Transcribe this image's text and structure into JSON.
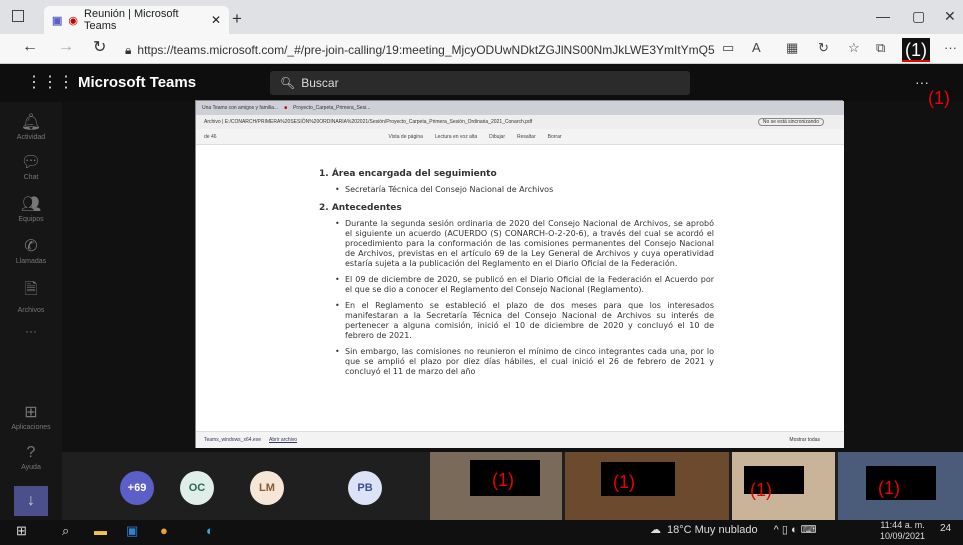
{
  "browser": {
    "tab_title": "Reunión | Microsoft Teams",
    "tab_close": "✕",
    "new_tab": "+",
    "url_prefix": "https://",
    "url": "https://teams.microsoft.com/_#/pre-join-calling/19:meeting_MjcyODUwNDktZGJlNS00NmJkLWE3YmItYmQ5NTcxN...",
    "redacted_label": "(1)",
    "win_min": "—",
    "win_max": "▢",
    "win_close": "✕",
    "more": "···"
  },
  "teams": {
    "brand": "Microsoft Teams",
    "search_placeholder": "Buscar",
    "more": "···",
    "rail": [
      {
        "label": "Actividad",
        "icon": "bell-icon"
      },
      {
        "label": "Chat",
        "icon": "chat-icon"
      },
      {
        "label": "Equipos",
        "icon": "teams-icon"
      },
      {
        "label": "Llamadas",
        "icon": "phone-icon"
      },
      {
        "label": "Archivos",
        "icon": "file-icon"
      },
      {
        "label": "···",
        "icon": "more-icon"
      },
      {
        "label": "Aplicaciones",
        "icon": "apps-icon"
      },
      {
        "label": "Ayuda",
        "icon": "help-icon"
      }
    ]
  },
  "shared": {
    "tab1": "Una Teams con amigos y familia...",
    "tab2": "Proyecto_Carpeta_Primera_Sesi...",
    "address": "Archivo | E:/CONARCH/PRIMERA%20SESIÓN%20ORDINARIA%202021/Sesión/Proyecto_Carpeta_Primera_Sesión_Ordinaria_2021_Conarch.pdf",
    "sync_badge": "No se está sincronizando",
    "toolbar": [
      "de 46",
      "Vista de página",
      "Lectura en voz alta",
      "Dibujar",
      "Resaltar",
      "Borrar"
    ],
    "download_file": "Teams_windows_x64.exe",
    "download_link": "Abrir archivo",
    "show_all": "Mostrar todas",
    "doc": {
      "h1": "1.  Área encargada del seguimiento",
      "b1": "Secretaría Técnica del Consejo Nacional de Archivos",
      "h2": "2.  Antecedentes",
      "bullets": [
        "Durante la segunda sesión ordinaria de 2020 del Consejo Nacional de Archivos, se aprobó el siguiente un acuerdo (ACUERDO (S) CONARCH-O-2-20-6), a través del cual se acordó el procedimiento para la conformación de las comisiones permanentes del Consejo Nacional de Archivos, previstas en el artículo 69 de la Ley General de Archivos y cuya operatividad estaría sujeta a la publicación del Reglamento en el Diario Oficial de la Federación.",
        "El 09 de diciembre de 2020, se publicó en el Diario Oficial de la Federación el Acuerdo por el que se dio a conocer el Reglamento del Consejo Nacional (Reglamento).",
        "En el Reglamento se estableció el plazo de dos meses para que los interesados manifestaran a la Secretaría Técnica del Consejo Nacional de Archivos su interés de pertenecer a alguna comisión, inició el 10 de diciembre de 2020 y concluyó el 10 de febrero de 2021.",
        "Sin embargo, las comisiones no reunieron el mínimo de cinco integrantes cada una, por lo que se amplió el plazo por diez días hábiles, el cual inició el 26 de febrero de 2021 y concluyó el 11 de marzo del año"
      ]
    }
  },
  "overlay_label": "(1)",
  "participants": {
    "extra_count": "+69",
    "avatars": [
      {
        "initials": "OC",
        "bg": "#dfeee9",
        "fg": "#2a6b5a"
      },
      {
        "initials": "LM",
        "bg": "#f5e6d8",
        "fg": "#8a5a2c"
      },
      {
        "initials": "PB",
        "bg": "#dce3f7",
        "fg": "#3d4f8f"
      }
    ],
    "video_labels": [
      "(1)",
      "(1)",
      "(1)",
      "(1)"
    ]
  },
  "taskbar": {
    "weather": "18°C  Muy nublado",
    "time": "11:44 a. m.",
    "date": "10/09/2021",
    "notif": "24"
  }
}
